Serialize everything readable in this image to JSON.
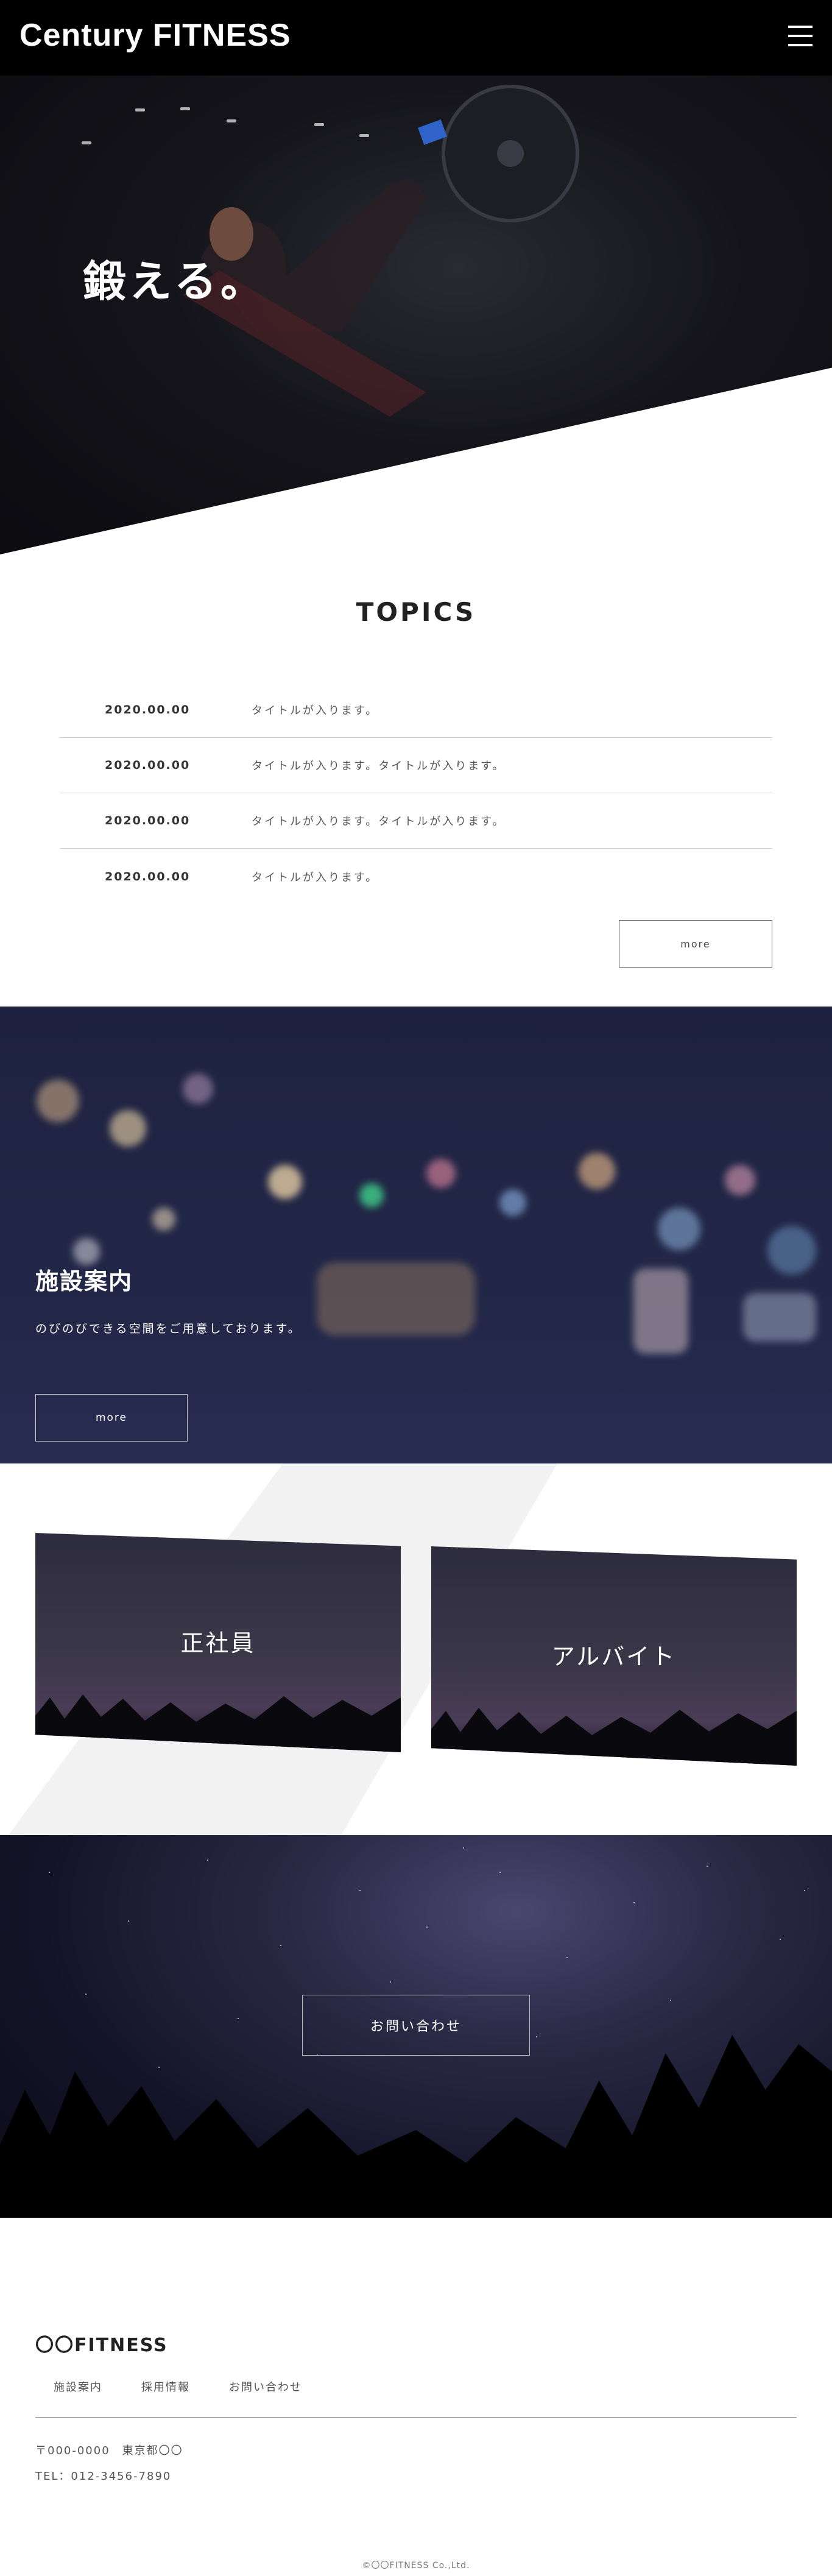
{
  "header": {
    "logo": "Century FITNESS",
    "menu_icon": "hamburger-menu-icon"
  },
  "hero": {
    "title": "鍛える。"
  },
  "topics": {
    "heading": "TOPICS",
    "items": [
      {
        "date": "2020.00.00",
        "title": "タイトルが入ります。"
      },
      {
        "date": "2020.00.00",
        "title": "タイトルが入ります。タイトルが入ります。"
      },
      {
        "date": "2020.00.00",
        "title": "タイトルが入ります。タイトルが入ります。"
      },
      {
        "date": "2020.00.00",
        "title": "タイトルが入ります。"
      }
    ],
    "more_label": "more"
  },
  "facility": {
    "title": "施設案内",
    "description": "のびのびできる空間をご用意しております。",
    "more_label": "more"
  },
  "recruit": {
    "full_time_label": "正社員",
    "part_time_label": "アルバイト"
  },
  "contact": {
    "button_label": "お問い合わせ"
  },
  "footer": {
    "logo": "〇〇FITNESS",
    "nav": [
      "施設案内",
      "採用情報",
      "お問い合わせ"
    ],
    "address": "〒000-0000　東京都〇〇",
    "tel": "TEL：012-3456-7890",
    "copyright": "©〇〇FITNESS Co.,Ltd."
  }
}
